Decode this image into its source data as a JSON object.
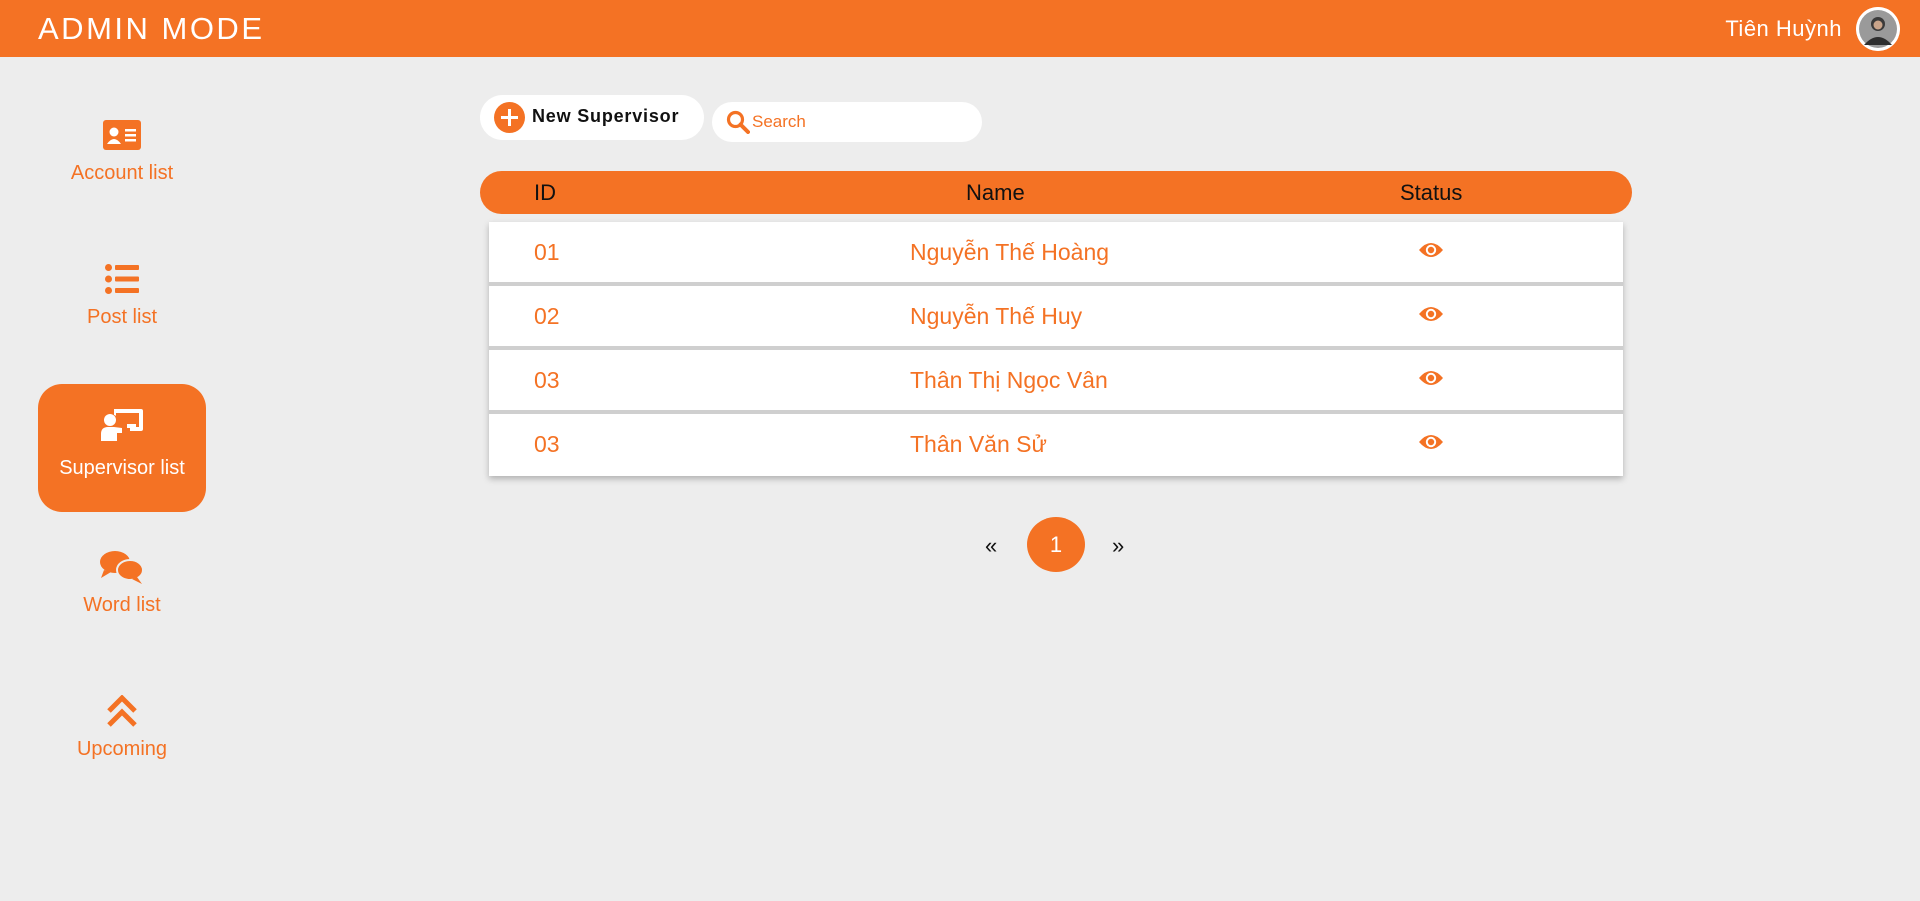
{
  "header": {
    "title": "ADMIN MODE",
    "user_name": "Tiên Huỳnh"
  },
  "sidebar": {
    "items": [
      {
        "label": "Account list",
        "icon": "id-card-icon",
        "active": false
      },
      {
        "label": "Post list",
        "icon": "list-icon",
        "active": false
      },
      {
        "label": "Supervisor list",
        "icon": "chalkboard-teacher-icon",
        "active": true
      },
      {
        "label": "Word list",
        "icon": "comments-icon",
        "active": false
      },
      {
        "label": "Upcoming",
        "icon": "double-chevron-up-icon",
        "active": false
      }
    ]
  },
  "toolbar": {
    "new_label": "New Supervisor",
    "search_placeholder": "Search"
  },
  "table": {
    "columns": [
      "ID",
      "Name",
      "Status"
    ],
    "rows": [
      {
        "id": "01",
        "name": "Nguyễn Thế Hoàng"
      },
      {
        "id": "02",
        "name": "Nguyễn Thế Huy"
      },
      {
        "id": "03",
        "name": "Thân Thị Ngọc Vân"
      },
      {
        "id": "03",
        "name": "Thân Văn Sử"
      }
    ]
  },
  "pagination": {
    "prev": "«",
    "current": "1",
    "next": "»"
  },
  "colors": {
    "accent": "#f47224",
    "background": "#ededed"
  }
}
